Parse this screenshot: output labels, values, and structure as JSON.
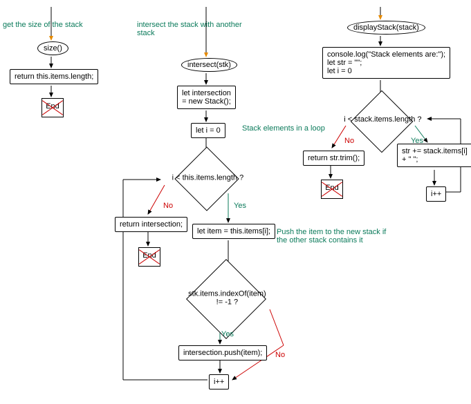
{
  "comments": {
    "size": "get the size of the stack",
    "intersect": "intersect the stack with another stack",
    "loop_note": "Stack elements in a loop",
    "push_note": "Push the item to the new stack if the other stack contains it"
  },
  "size_fn": {
    "name": "size()",
    "body": "return this.items.length;",
    "end": "End"
  },
  "intersect_fn": {
    "name": "intersect(stk)",
    "init": "let intersection\n= new Stack();",
    "let_i": "let i = 0",
    "cond": "i < this.items.length ?",
    "ret": "return intersection;",
    "item": "let item = this.items[i];",
    "idx_cond": "stk.items.indexOf(item)\n!= -1 ?",
    "push": "intersection.push(item);",
    "inc": "i++",
    "end": "End"
  },
  "display_fn": {
    "name": "displayStack(stack)",
    "body": "console.log(\"Stack elements are:\");\nlet str = \"\";\nlet i = 0",
    "cond": "i < stack.items.length ?",
    "ret": "return str.trim();",
    "append": "str += stack.items[i]\n+ \" \";",
    "inc": "i++",
    "end": "End"
  },
  "labels": {
    "yes": "Yes",
    "no": "No"
  }
}
